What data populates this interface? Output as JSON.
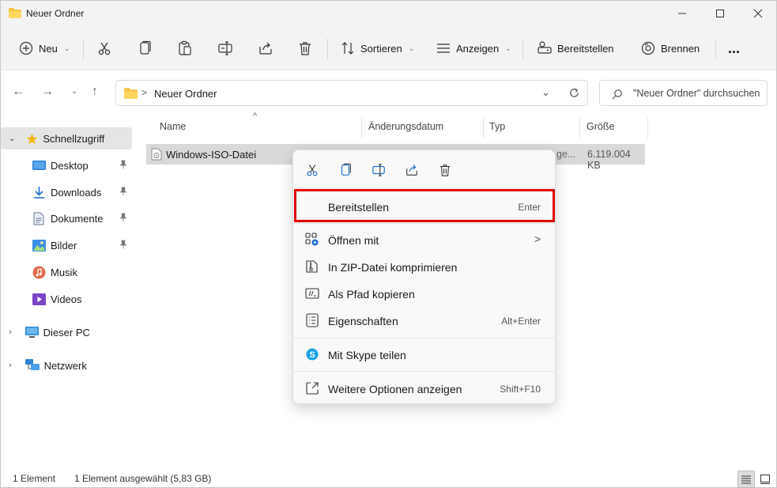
{
  "window": {
    "title": "Neuer Ordner"
  },
  "toolbar": {
    "new_label": "Neu",
    "sort_label": "Sortieren",
    "view_label": "Anzeigen",
    "mount_label": "Bereitstellen",
    "burn_label": "Brennen",
    "more_label": "..."
  },
  "address": {
    "folder": "Neuer Ordner",
    "separator": ">"
  },
  "search": {
    "placeholder": "\"Neuer Ordner\" durchsuchen"
  },
  "sidebar": {
    "quick_access": "Schnellzugriff",
    "items": [
      {
        "label": "Desktop"
      },
      {
        "label": "Downloads"
      },
      {
        "label": "Dokumente"
      },
      {
        "label": "Bilder"
      },
      {
        "label": "Musik"
      },
      {
        "label": "Videos"
      }
    ],
    "this_pc": "Dieser PC",
    "network": "Netzwerk"
  },
  "columns": {
    "name": "Name",
    "date": "Änderungsdatum",
    "type": "Typ",
    "size": "Größe"
  },
  "file": {
    "name": "Windows-ISO-Datei",
    "type_partial": "ge...",
    "size": "6.119.004 KB"
  },
  "context_menu": {
    "items": [
      {
        "label": "Bereitstellen",
        "shortcut": "Enter"
      },
      {
        "label": "Öffnen mit",
        "shortcut": ">"
      },
      {
        "label": "In ZIP-Datei komprimieren",
        "shortcut": ""
      },
      {
        "label": "Als Pfad kopieren",
        "shortcut": ""
      },
      {
        "label": "Eigenschaften",
        "shortcut": "Alt+Enter"
      },
      {
        "label": "Mit Skype teilen",
        "shortcut": ""
      },
      {
        "label": "Weitere Optionen anzeigen",
        "shortcut": "Shift+F10"
      }
    ]
  },
  "status": {
    "count": "1 Element",
    "selected": "1 Element ausgewählt (5,83 GB)"
  },
  "colors": {
    "highlight": "#e00000",
    "folder": "#f4c542",
    "accent": "#0067c0"
  }
}
